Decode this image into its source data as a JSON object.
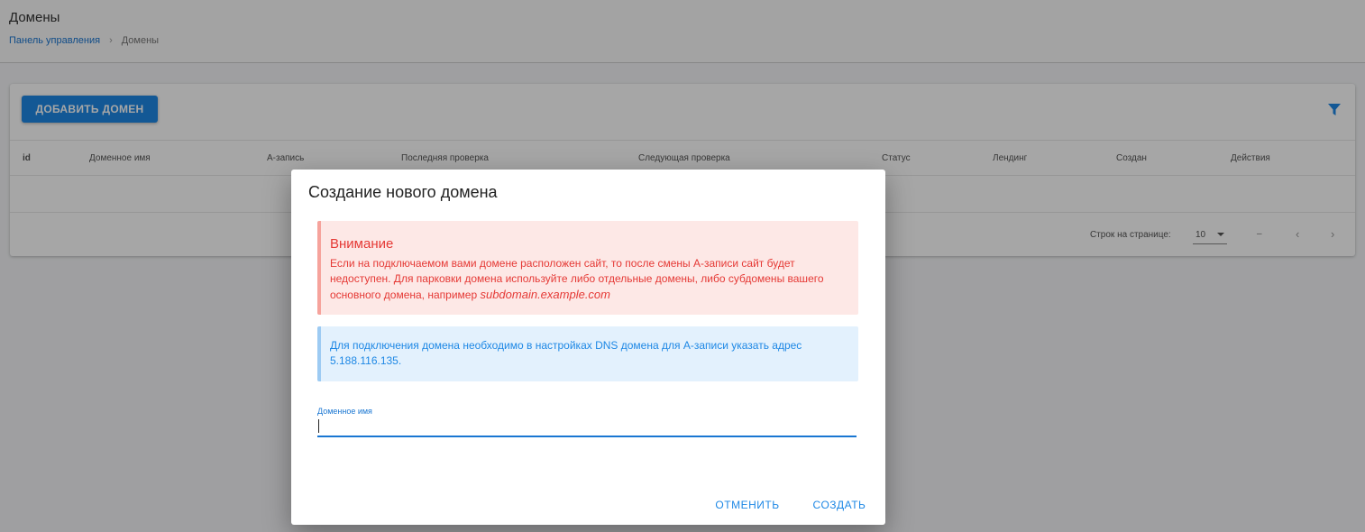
{
  "header": {
    "title": "Домены",
    "breadcrumb": {
      "home": "Панель управления",
      "separator": "›",
      "current": "Домены"
    }
  },
  "toolbar": {
    "add_button_label": "ДОБАВИТЬ ДОМЕН",
    "filter_icon": "filter-icon"
  },
  "table": {
    "columns": [
      "id",
      "Доменное имя",
      "A-запись",
      "Последняя проверка",
      "Следующая проверка",
      "Статус",
      "Лендинг",
      "Создан",
      "Действия"
    ]
  },
  "pagination": {
    "rows_per_page_label": "Строк на странице:",
    "rows_per_page_value": "10",
    "range": "–",
    "prev_icon": "‹",
    "next_icon": "›"
  },
  "dialog": {
    "title": "Создание нового домена",
    "warning": {
      "heading": "Внимание",
      "text": "Если на подключаемом вами домене расположен сайт, то после смены A-записи сайт будет недоступен. Для парковки домена используйте либо отдельные домены, либо субдомены вашего основного домена, например",
      "example": "subdomain.example.com"
    },
    "info": {
      "text": "Для подключения домена необходимо в настройках DNS домена для A-записи указать адрес 5.188.116.135."
    },
    "field": {
      "label": "Доменное имя",
      "value": ""
    },
    "cancel_label": "ОТМЕНИТЬ",
    "create_label": "СОЗДАТЬ"
  },
  "colors": {
    "primary": "#1e88e5",
    "warning_text": "#e53935",
    "warning_bg": "#fde8e6",
    "info_bg": "#e3f1fd"
  }
}
